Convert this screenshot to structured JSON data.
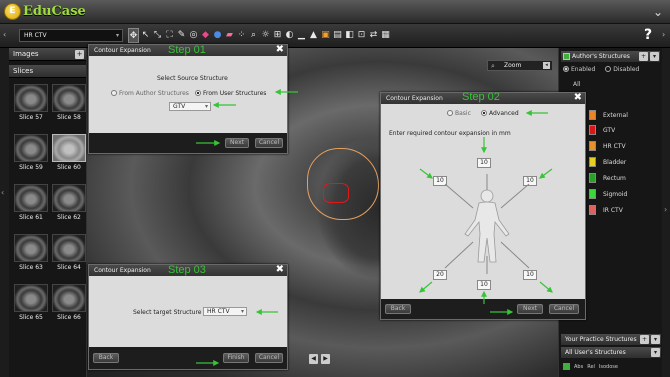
{
  "app": {
    "name": "EduCase",
    "logo_letter": "E"
  },
  "toolbar": {
    "structure_select": "HR CTV",
    "tool_icons": [
      "move-icon",
      "cursor-icon",
      "pan-icon",
      "fit-icon",
      "pen-icon",
      "circle-select-icon",
      "shapes-icon",
      "brush-icon",
      "eraser-icon",
      "grid-icon",
      "zoom-icon",
      "brightness-icon",
      "window-icon",
      "contrast-icon",
      "ruler-icon",
      "chart-icon",
      "comment-icon",
      "image-icon",
      "save-icon",
      "screenshot-icon",
      "compare-icon",
      "layers-icon"
    ],
    "help": "?"
  },
  "left_panel": {
    "images_label": "Images",
    "slices_label": "Slices",
    "slices": [
      "Slice 57",
      "Slice 58",
      "Slice 59",
      "Slice 60",
      "Slice 61",
      "Slice 62",
      "Slice 63",
      "Slice 64",
      "Slice 65",
      "Slice 66"
    ],
    "highlighted": "Slice 60"
  },
  "viewer": {
    "zoom_label": "Zoom"
  },
  "right_panel": {
    "authors_structures": "Author's Structures",
    "enabled": "Enabled",
    "disabled": "Disabled",
    "all": "All",
    "structures": [
      {
        "name": "External",
        "color": "#e8842a"
      },
      {
        "name": "GTV",
        "color": "#d81818"
      },
      {
        "name": "HR CTV",
        "color": "#e8902a"
      },
      {
        "name": "Bladder",
        "color": "#e8d020"
      },
      {
        "name": "Rectum",
        "color": "#2aa02a"
      },
      {
        "name": "Sigmoid",
        "color": "#3ad83a"
      },
      {
        "name": "IR CTV",
        "color": "#e06060"
      }
    ],
    "your_practice": "Your Practice Structures",
    "all_users": "All User's Structures",
    "bottom_abs": "Abs",
    "bottom_rel": "Rel",
    "bottom_isodose": "Isodose"
  },
  "dialog1": {
    "title": "Contour Expansion",
    "step": "Step 01",
    "prompt": "Select Source Structure",
    "opt_author": "From Author Structures",
    "opt_user": "From User Structures",
    "selected": "GTV",
    "next": "Next",
    "cancel": "Cancel"
  },
  "dialog2": {
    "title": "Contour Expansion",
    "step": "Step 02",
    "opt_basic": "Basic",
    "opt_advanced": "Advanced",
    "prompt": "Enter required contour expansion in mm",
    "val_top": "10",
    "val_left": "10",
    "val_right": "10",
    "val_bl": "20",
    "val_bottom": "10",
    "val_br": "10",
    "back": "Back",
    "next": "Next",
    "cancel": "Cancel"
  },
  "dialog3": {
    "title": "Contour Expansion",
    "step": "Step 03",
    "prompt": "Select target Structure",
    "selected": "HR CTV",
    "back": "Back",
    "finish": "Finish",
    "cancel": "Cancel"
  }
}
